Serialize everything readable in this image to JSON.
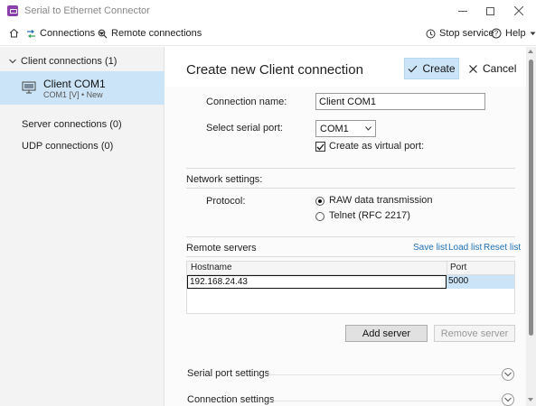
{
  "window": {
    "title": "Serial to Ethernet Connector"
  },
  "toolbar": {
    "connections_label": "Connections",
    "remote_label": "Remote connections",
    "stop_label": "Stop service",
    "help_label": "Help"
  },
  "sidebar": {
    "client_group": "Client connections (1)",
    "selected_item": {
      "name": "Client COM1",
      "subtitle": "COM1 [V] • New"
    },
    "server_group": "Server connections (0)",
    "udp_group": "UDP connections (0)"
  },
  "main": {
    "title": "Create new Client connection",
    "create_label": "Create",
    "cancel_label": "Cancel",
    "connection_name_label": "Connection name:",
    "connection_name_value": "Client COM1",
    "serial_port_label": "Select serial port:",
    "serial_port_value": "COM1",
    "virtual_port_label": "Create as virtual port:",
    "virtual_port_checked": true,
    "network_settings_title": "Network settings:",
    "protocol_label": "Protocol:",
    "protocol_options": [
      "RAW data transmission",
      "Telnet (RFC 2217)"
    ],
    "protocol_selected": "RAW data transmission",
    "remote_servers_title": "Remote servers",
    "save_list": "Save list",
    "load_list": "Load list",
    "reset_list": "Reset list",
    "grid_headers": [
      "Hostname",
      "Port"
    ],
    "grid_rows": [
      {
        "hostname": "192.168.24.43",
        "port": "5000"
      }
    ],
    "add_server_label": "Add server",
    "remove_server_label": "Remove server",
    "serial_port_settings_label": "Serial port settings",
    "connection_settings_label": "Connection settings"
  },
  "colors": {
    "accent_selected": "#cce4f7",
    "link": "#1f6fb5",
    "app_icon": "#8b3fa8"
  }
}
